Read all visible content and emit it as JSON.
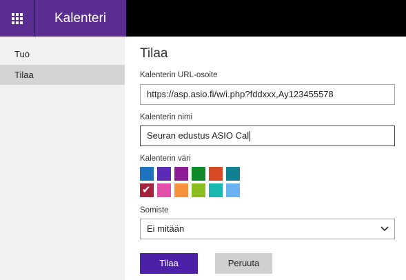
{
  "header": {
    "app_title": "Kalenteri",
    "launcher_icon": "app-launcher-waffle-icon"
  },
  "sidebar": {
    "items": [
      {
        "label": "Tuo",
        "selected": false
      },
      {
        "label": "Tilaa",
        "selected": true
      }
    ]
  },
  "form": {
    "heading": "Tilaa",
    "url_label": "Kalenterin URL-osoite",
    "url_value": "https://asp.asio.fi/w/i.php?fddxxx,Ay123455578",
    "name_label": "Kalenterin nimi",
    "name_value": "Seuran edustus ASIO Cal",
    "color_label": "Kalenterin väri",
    "colors_row1": [
      "#1e73be",
      "#5a2bb4",
      "#8c1d96",
      "#0f8a2b",
      "#d84a26",
      "#118090"
    ],
    "colors_row2": [
      "#a4243b",
      "#e14fa8",
      "#f7913d",
      "#8cbd20",
      "#1ab8b0",
      "#6ab2f0"
    ],
    "selected_color": "#a4243b",
    "charm_label": "Somiste",
    "charm_value": "Ei mitään",
    "submit_label": "Tilaa",
    "cancel_label": "Peruuta"
  }
}
